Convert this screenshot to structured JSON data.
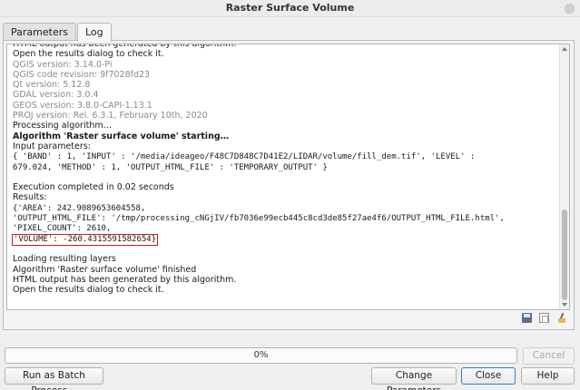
{
  "window": {
    "title": "Raster Surface Volume"
  },
  "tabs": [
    {
      "label": "Parameters",
      "active": false
    },
    {
      "label": "Log",
      "active": true
    }
  ],
  "log": {
    "lines": [
      {
        "text": "HTML output has been generated by this algorithm.",
        "style": "normal"
      },
      {
        "text": "Open the results dialog to check it.",
        "style": "normal"
      },
      {
        "text": "QGIS version: 3.14.0-Pi",
        "style": "grey"
      },
      {
        "text": "QGIS code revision: 9f7028fd23",
        "style": "grey"
      },
      {
        "text": "Qt version: 5.12.8",
        "style": "grey"
      },
      {
        "text": "GDAL version: 3.0.4",
        "style": "grey"
      },
      {
        "text": "GEOS version: 3.8.0-CAPI-1.13.1",
        "style": "grey"
      },
      {
        "text": "PROJ version: Rel. 6.3.1, February 10th, 2020",
        "style": "grey"
      },
      {
        "text": "Processing algorithm…",
        "style": "normal"
      },
      {
        "text": "Algorithm 'Raster surface volume' starting…",
        "style": "bold"
      },
      {
        "text": "Input parameters:",
        "style": "normal"
      },
      {
        "text": "{ 'BAND' : 1, 'INPUT' : '/media/ideageo/F48C7D848C7D41E2/LIDAR/volume/fill_dem.tif', 'LEVEL' :",
        "style": "mono"
      },
      {
        "text": "679.024, 'METHOD' : 1, 'OUTPUT_HTML_FILE' : 'TEMPORARY_OUTPUT' }",
        "style": "mono"
      },
      {
        "text": "",
        "style": "normal"
      },
      {
        "text": "Execution completed in 0.02 seconds",
        "style": "normal"
      },
      {
        "text": "Results:",
        "style": "normal"
      },
      {
        "text": "{'AREA': 242.9089653604558,",
        "style": "mono"
      },
      {
        "text": "'OUTPUT_HTML_FILE': '/tmp/processing_cNGjIV/fb7036e99ecb445c8cd3de85f27ae4f6/OUTPUT_HTML_FILE.html',",
        "style": "mono"
      },
      {
        "text": "'PIXEL_COUNT': 2610,",
        "style": "mono"
      },
      {
        "text": "'VOLUME': -260.4315591582654}",
        "style": "mono-hl"
      },
      {
        "text": "",
        "style": "normal"
      },
      {
        "text": "Loading resulting layers",
        "style": "normal"
      },
      {
        "text": "Algorithm 'Raster surface volume' finished",
        "style": "normal"
      },
      {
        "text": "HTML output has been generated by this algorithm.",
        "style": "normal"
      },
      {
        "text": "Open the results dialog to check it.",
        "style": "normal"
      }
    ],
    "toolbar_icons": [
      "save-log-icon",
      "copy-log-icon",
      "clear-log-icon"
    ]
  },
  "progress": {
    "label": "0%",
    "value": 0
  },
  "buttons": {
    "cancel": "Cancel",
    "batch": "Run as Batch Process…",
    "change_parameters": "Change Parameters",
    "close": "Close",
    "help": "Help"
  },
  "colors": {
    "highlight_box": "#d11c1c",
    "grey_text": "#8a8a8a"
  }
}
